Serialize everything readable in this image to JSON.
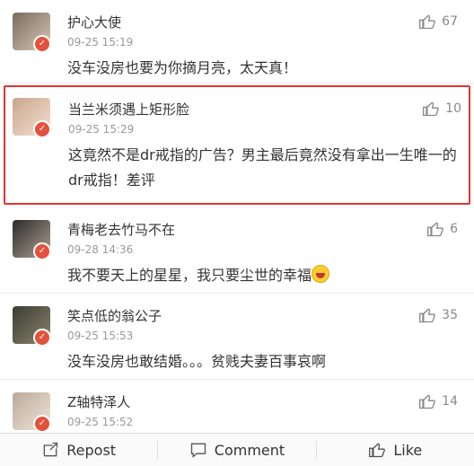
{
  "comments": [
    {
      "name": "护心大使",
      "time": "09-25 15:19",
      "text": "没车没房也要为你摘月亮，太天真！",
      "likes": "67"
    },
    {
      "name": "当兰米须遇上矩形脸",
      "time": "09-25 15:29",
      "text": "这竟然不是dr戒指的广告？男主最后竟然没有拿出一生唯一的dr戒指！差评",
      "likes": "10"
    },
    {
      "name": "青梅老去竹马不在",
      "time": "09-28 14:36",
      "text": "我不要天上的星星，我只要尘世的幸福",
      "likes": "6"
    },
    {
      "name": "笑点低的翁公子",
      "time": "09-25 15:53",
      "text": "没车没房也敢结婚。。。贫贱夫妻百事哀啊",
      "likes": "35"
    },
    {
      "name": "Z轴特泽人",
      "time": "09-25 15:52",
      "text": "",
      "likes": "14"
    }
  ],
  "toolbar": {
    "repost": "Repost",
    "comment": "Comment",
    "like": "Like"
  },
  "icons": {
    "like": "thumbs-up-icon",
    "badge": "weibo-badge-icon",
    "repost": "repost-icon",
    "comment": "comment-icon"
  },
  "colors": {
    "highlight_border": "#e03434",
    "badge": "#e2523c"
  }
}
